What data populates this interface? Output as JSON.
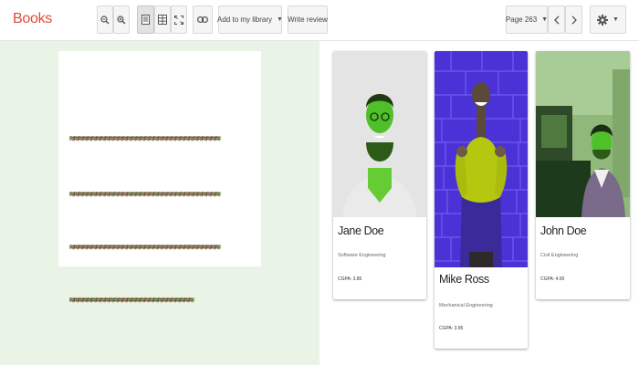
{
  "header": {
    "brand": "Books",
    "add_to_library": "Add to my library",
    "write_review": "Write review",
    "page_label": "Page 263"
  },
  "icons": {
    "zoom_out": "zoom-out-icon",
    "zoom_in": "zoom-in-icon",
    "single_page": "single-page-icon",
    "thumbnails": "thumbnail-view-icon",
    "fullscreen": "fullscreen-icon",
    "link": "link-icon",
    "prev": "chevron-left-icon",
    "next": "chevron-right-icon",
    "settings": "gear-icon"
  },
  "colors": {
    "brand": "#dd4b39",
    "left_panel_bg": "#e9f3e6"
  },
  "cards": [
    {
      "name": "Jane Doe",
      "department": "Software Engineering",
      "gpa": "CGPA: 3.85"
    },
    {
      "name": "Mike Ross",
      "department": "Mechanical Engineering",
      "gpa": "CGPA: 3.95"
    },
    {
      "name": "John Doe",
      "department": "Civil Engineering",
      "gpa": "CGPA: 4.00"
    }
  ]
}
